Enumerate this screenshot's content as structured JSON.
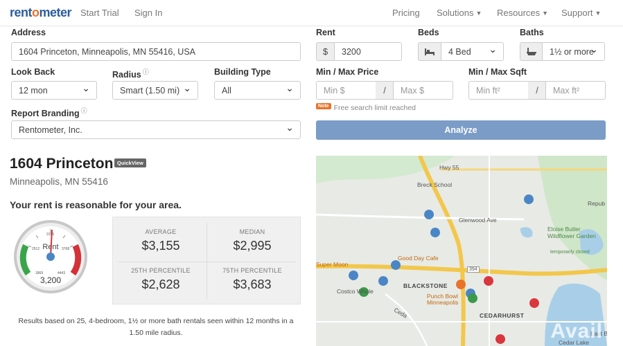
{
  "nav": {
    "logo_prefix": "rent",
    "logo_o": "o",
    "logo_suffix": "meter",
    "start_trial": "Start Trial",
    "sign_in": "Sign In",
    "pricing": "Pricing",
    "solutions": "Solutions",
    "resources": "Resources",
    "support": "Support"
  },
  "form": {
    "address_label": "Address",
    "address_value": "1604 Princeton, Minneapolis, MN 55416, USA",
    "rent_label": "Rent",
    "rent_prefix": "$",
    "rent_value": "3200",
    "beds_label": "Beds",
    "beds_value": "4 Bed",
    "baths_label": "Baths",
    "baths_value": "1½ or more",
    "lookback_label": "Look Back",
    "lookback_value": "12 mon",
    "radius_label": "Radius",
    "radius_value": "Smart (1.50 mi)",
    "building_label": "Building Type",
    "building_value": "All",
    "price_label": "Min / Max Price",
    "min_price_placeholder": "Min $",
    "max_price_placeholder": "Max $",
    "sqft_label": "Min / Max Sqft",
    "min_sqft_placeholder": "Min ft²",
    "max_sqft_placeholder": "Max ft²",
    "slash": "/",
    "branding_label": "Report Branding",
    "branding_value": "Rentometer, Inc.",
    "note_badge": "Note",
    "note_text": "Free search limit reached",
    "analyze": "Analyze"
  },
  "result": {
    "title": "1604 Princeton",
    "quickview": "QuickView",
    "subtitle": "Minneapolis, MN 55416",
    "verdict": "Your rent is reasonable for your area.",
    "gauge": {
      "label": "Rent",
      "value": "3,200",
      "tick_1": "2512",
      "tick_2": "3155",
      "tick_3": "3768",
      "tick_min": "1869",
      "tick_max": "4443"
    },
    "stats": {
      "average_label": "AVERAGE",
      "average": "$3,155",
      "median_label": "MEDIAN",
      "median": "$2,995",
      "p25_label": "25TH PERCENTILE",
      "p25": "$2,628",
      "p75_label": "75TH PERCENTILE",
      "p75": "$3,683"
    },
    "footnote": "Results based on 25, 4-bedroom, 1½ or more bath rentals seen within 12 months in a 1.50 mile radius."
  },
  "map": {
    "labels": {
      "hwy55": "Hwy 55",
      "breck": "Breck School",
      "glenwood": "Glenwood Ave",
      "eloise": "Eloise Butler Wildflower Garden",
      "eloise_sub": "temporarily closed",
      "repub": "Repub Brewin",
      "gooddays": "Good Day Cafe",
      "supermoon": "Super Moon",
      "blackstone": "BLACKSTONE",
      "costco": "Costco Whole",
      "punch": "Punch Bowl",
      "punch2": "Minneapolis",
      "cedarhurst": "CEDARHURST",
      "cedarlake": "Cedar Lake",
      "ceda": "Ceda",
      "east": "East B",
      "i394": "394"
    },
    "watermark": "Avail"
  },
  "colors": {
    "brand_blue": "#2d5d9b",
    "accent_orange": "#e8732a",
    "analyze_button": "#7a9cc6",
    "pin_blue": "#4a86c5",
    "pin_red": "#d9363e",
    "pin_green": "#3b9a4a",
    "pin_orange": "#e8732a"
  }
}
